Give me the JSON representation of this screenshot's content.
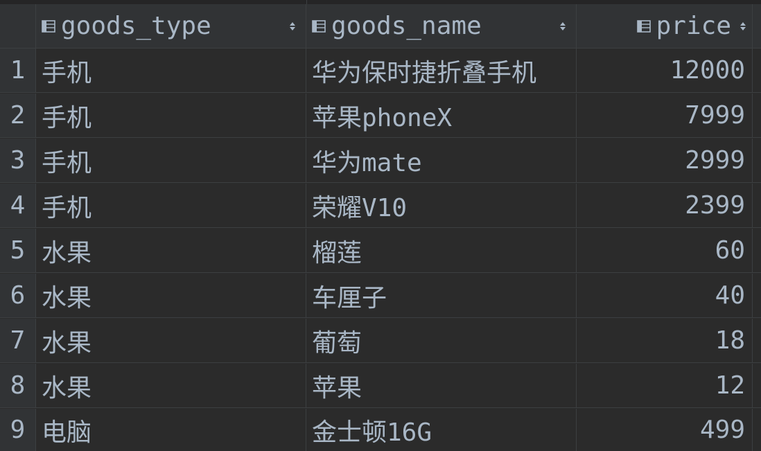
{
  "table": {
    "columns": [
      {
        "label": "goods_type",
        "icon": "column-icon",
        "sort_icon": "sort-toggle-icon"
      },
      {
        "label": "goods_name",
        "icon": "column-icon",
        "sort_icon": "sort-toggle-icon"
      },
      {
        "label": "price",
        "icon": "column-icon",
        "sort_icon": "sort-toggle-icon"
      }
    ],
    "rows": [
      {
        "num": "1",
        "goods_type": "手机",
        "goods_name": "华为保时捷折叠手机",
        "price": "12000"
      },
      {
        "num": "2",
        "goods_type": "手机",
        "goods_name": "苹果phoneX",
        "price": "7999"
      },
      {
        "num": "3",
        "goods_type": "手机",
        "goods_name": "华为mate",
        "price": "2999"
      },
      {
        "num": "4",
        "goods_type": "手机",
        "goods_name": "荣耀V10",
        "price": "2399"
      },
      {
        "num": "5",
        "goods_type": "水果",
        "goods_name": "榴莲",
        "price": "60"
      },
      {
        "num": "6",
        "goods_type": "水果",
        "goods_name": "车厘子",
        "price": "40"
      },
      {
        "num": "7",
        "goods_type": "水果",
        "goods_name": "葡萄",
        "price": "18"
      },
      {
        "num": "8",
        "goods_type": "水果",
        "goods_name": "苹果",
        "price": "12"
      },
      {
        "num": "9",
        "goods_type": "电脑",
        "goods_name": "金士顿16G",
        "price": "499"
      }
    ]
  },
  "colors": {
    "background": "#2b2b2b",
    "header_background": "#313335",
    "gridline": "#3c3f41",
    "text": "#a9b7c6"
  }
}
